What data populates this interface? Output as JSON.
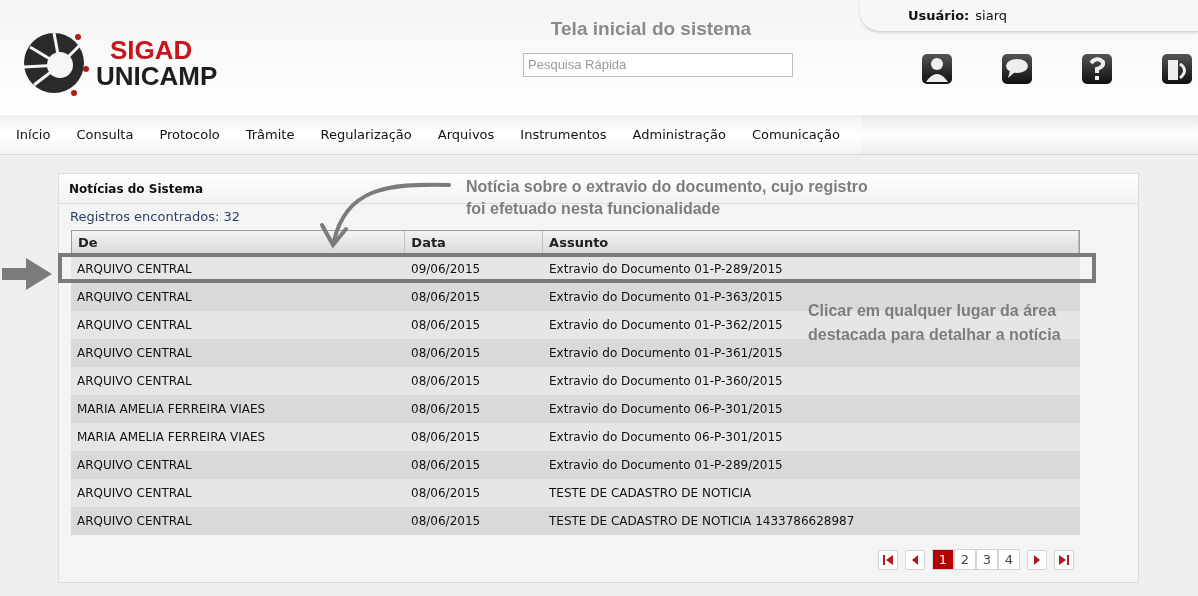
{
  "header": {
    "logo_top": "SIGAD",
    "logo_bottom": "UNICAMP",
    "title": "Tela inicial do sistema",
    "search": {
      "placeholder": "Pesquisa Rápida"
    },
    "user_label": "Usuário:",
    "user_name": "siarq",
    "toolbar": [
      {
        "kind": "user"
      },
      {
        "kind": "chat"
      },
      {
        "kind": "help"
      },
      {
        "kind": "exit"
      }
    ]
  },
  "menu": [
    "Início",
    "Consulta",
    "Protocolo",
    "Trâmite",
    "Regularização",
    "Arquivos",
    "Instrumentos",
    "Administração",
    "Comunicação"
  ],
  "panel": {
    "title": "Notícias do Sistema",
    "count": "Registros encontrados: 32",
    "table": {
      "columns": [
        "De",
        "Data",
        "Assunto"
      ],
      "rows": [
        {
          "cells": [
            "ARQUIVO CENTRAL",
            "09/06/2015",
            "Extravio do Documento 01-P-289/2015"
          ],
          "highlighted": true
        },
        {
          "cells": [
            "ARQUIVO CENTRAL",
            "08/06/2015",
            "Extravio do Documento 01-P-363/2015"
          ],
          "highlighted": false
        },
        {
          "cells": [
            "ARQUIVO CENTRAL",
            "08/06/2015",
            "Extravio do Documento 01-P-362/2015"
          ],
          "highlighted": false
        },
        {
          "cells": [
            "ARQUIVO CENTRAL",
            "08/06/2015",
            "Extravio do Documento 01-P-361/2015"
          ],
          "highlighted": false
        },
        {
          "cells": [
            "ARQUIVO CENTRAL",
            "08/06/2015",
            "Extravio do Documento 01-P-360/2015"
          ],
          "highlighted": false
        },
        {
          "cells": [
            "MARIA AMELIA FERREIRA VIAES",
            "08/06/2015",
            "Extravio do Documento 06-P-301/2015"
          ],
          "highlighted": false
        },
        {
          "cells": [
            "MARIA AMELIA FERREIRA VIAES",
            "08/06/2015",
            "Extravio do Documento 06-P-301/2015"
          ],
          "highlighted": false
        },
        {
          "cells": [
            "ARQUIVO CENTRAL",
            "08/06/2015",
            "Extravio do Documento 01-P-289/2015"
          ],
          "highlighted": false
        },
        {
          "cells": [
            "ARQUIVO CENTRAL",
            "08/06/2015",
            "TESTE DE CADASTRO DE NOTICIA"
          ],
          "highlighted": false
        },
        {
          "cells": [
            "ARQUIVO CENTRAL",
            "08/06/2015",
            "TESTE DE CADASTRO DE NOTICIA 1433786628987"
          ],
          "highlighted": false
        }
      ]
    },
    "pagination": {
      "nav": [
        {
          "kind": "first"
        },
        {
          "kind": "prev"
        }
      ],
      "pages": [
        {
          "label": "1",
          "selected": true
        },
        {
          "label": "2",
          "selected": false
        },
        {
          "label": "3",
          "selected": false
        },
        {
          "label": "4",
          "selected": false
        }
      ],
      "nav_end": [
        {
          "kind": "next"
        },
        {
          "kind": "last"
        }
      ]
    }
  },
  "annotations": {
    "top": "Notícia sobre o extravio do documento, cujo registro foi efetuado nesta funcionalidade",
    "right": "Clicar em qualquer lugar da área destacada para detalhar a notícia"
  }
}
